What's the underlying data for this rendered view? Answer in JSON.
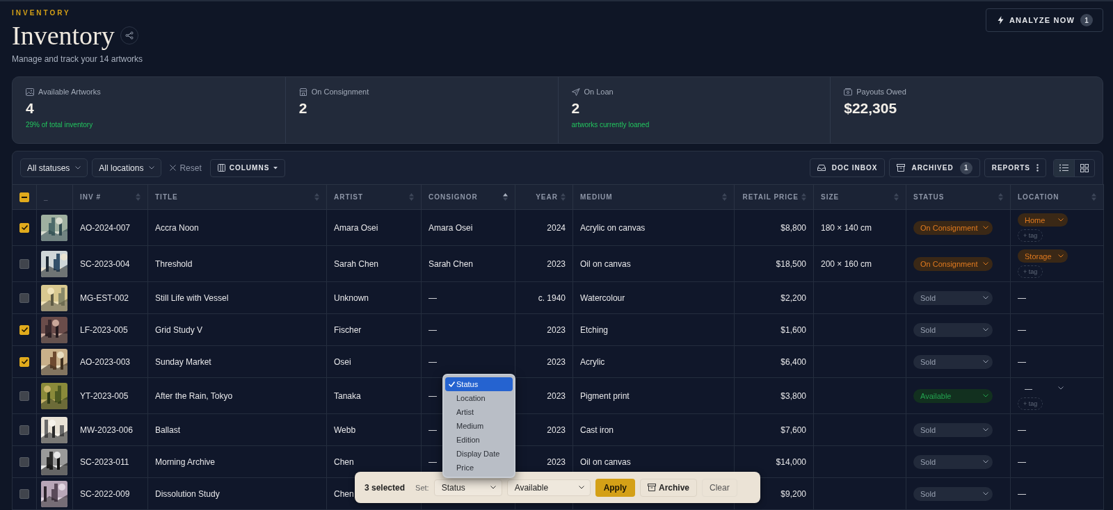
{
  "eyebrow": "INVENTORY",
  "title": "Inventory",
  "subtitle": "Manage and track your 14 artworks",
  "analyze": {
    "label": "ANALYZE NOW",
    "count": "1"
  },
  "stats": [
    {
      "label": "Available Artworks",
      "value": "4",
      "note": "29% of total inventory"
    },
    {
      "label": "On Consignment",
      "value": "2"
    },
    {
      "label": "On Loan",
      "value": "2",
      "note": "artworks currently loaned"
    },
    {
      "label": "Payouts Owed",
      "value": "$22,305"
    }
  ],
  "filters": [
    {
      "label": "All statuses"
    },
    {
      "label": "All locations"
    }
  ],
  "reset": "Reset",
  "columns_button": "COLUMNS",
  "actions": [
    {
      "kind": "inbox",
      "label": "DOC INBOX"
    },
    {
      "kind": "archive",
      "label": "ARCHIVED",
      "count": "1"
    },
    {
      "kind": "menu",
      "label": "REPORTS"
    }
  ],
  "views": [
    {
      "kind": "list",
      "selected": true
    },
    {
      "kind": "grid",
      "selected": false
    }
  ],
  "table": {
    "header_checkbox": {
      "checked": true,
      "indeterminate": true
    },
    "columns": [
      {
        "label": "_"
      },
      {
        "label": "INV #",
        "sorted": false
      },
      {
        "label": "TITLE",
        "sorted": false
      },
      {
        "label": "ARTIST",
        "sorted": false
      },
      {
        "label": "CONSIGNOR",
        "sorted": true
      },
      {
        "label": "YEAR",
        "sorted": false
      },
      {
        "label": "MEDIUM",
        "sorted": false
      },
      {
        "label": "RETAIL PRICE",
        "sorted": false
      },
      {
        "label": "SIZE",
        "sorted": false
      },
      {
        "label": "STATUS",
        "sorted": false
      },
      {
        "label": "LOCATION",
        "sorted": false
      }
    ],
    "rows": [
      {
        "selected": true,
        "inv": "AO-2024-007",
        "title": "Accra Noon",
        "artist": "Amara Osei",
        "consignor": "Amara Osei",
        "year": "2024",
        "medium": "Acrylic on canvas",
        "price": "$8,800",
        "size": "180 × 140 cm",
        "status": {
          "kind": "consignment",
          "label": "On Consignment"
        },
        "location": {
          "kind": "tag",
          "value": "Home",
          "add": "+ tag"
        }
      },
      {
        "selected": false,
        "inv": "SC-2023-004",
        "title": "Threshold",
        "artist": "Sarah Chen",
        "consignor": "Sarah Chen",
        "year": "2023",
        "medium": "Oil on canvas",
        "price": "$18,500",
        "size": "200 × 160 cm",
        "status": {
          "kind": "consignment",
          "label": "On Consignment"
        },
        "location": {
          "kind": "tag",
          "value": "Storage",
          "add": "+ tag"
        }
      },
      {
        "selected": false,
        "inv": "MG-EST-002",
        "title": "Still Life with Vessel",
        "artist": "Unknown",
        "consignor": "—",
        "year": "c. 1940",
        "medium": "Watercolour",
        "price": "$2,200",
        "status": {
          "kind": "sold",
          "label": "Sold"
        },
        "location": {
          "kind": "none",
          "value": "—"
        }
      },
      {
        "selected": true,
        "inv": "LF-2023-005",
        "title": "Grid Study V",
        "artist": "Fischer",
        "consignor": "—",
        "year": "2023",
        "medium": "Etching",
        "price": "$1,600",
        "status": {
          "kind": "sold",
          "label": "Sold"
        },
        "location": {
          "kind": "none",
          "value": "—"
        }
      },
      {
        "selected": true,
        "inv": "AO-2023-003",
        "title": "Sunday Market",
        "artist": "Osei",
        "consignor": "—",
        "year": "2023",
        "medium": "Acrylic",
        "price": "$6,400",
        "status": {
          "kind": "sold",
          "label": "Sold"
        },
        "location": {
          "kind": "none",
          "value": "—"
        }
      },
      {
        "selected": false,
        "inv": "YT-2023-005",
        "title": "After the Rain, Tokyo",
        "artist": "Tanaka",
        "consignor": "—",
        "year": "2023",
        "medium": "Pigment print",
        "price": "$3,800",
        "status": {
          "kind": "available",
          "label": "Available"
        },
        "location": {
          "kind": "select",
          "value": "—",
          "add": "+ tag"
        }
      },
      {
        "selected": false,
        "inv": "MW-2023-006",
        "title": "Ballast",
        "artist": "Webb",
        "consignor": "—",
        "year": "2023",
        "medium": "Cast iron",
        "price": "$7,600",
        "status": {
          "kind": "sold",
          "label": "Sold"
        },
        "location": {
          "kind": "none",
          "value": "—"
        }
      },
      {
        "selected": false,
        "inv": "SC-2023-011",
        "title": "Morning Archive",
        "artist": "Chen",
        "consignor": "—",
        "year": "2023",
        "medium": "Oil on canvas",
        "price": "$14,000",
        "status": {
          "kind": "sold",
          "label": "Sold"
        },
        "location": {
          "kind": "none",
          "value": "—"
        }
      },
      {
        "selected": false,
        "inv": "SC-2022-009",
        "title": "Dissolution Study",
        "artist": "Chen",
        "price": "$9,200",
        "status": {
          "kind": "sold",
          "label": "Sold"
        },
        "location": {
          "kind": "none",
          "value": "—"
        }
      }
    ]
  },
  "bulk": {
    "count": "3 selected",
    "set_label": "Set:",
    "field": "Status",
    "value": "Available",
    "apply": "Apply",
    "archive": "Archive",
    "clear": "Clear",
    "menu": [
      {
        "label": "Status",
        "selected": true
      },
      {
        "label": "Location",
        "selected": false
      },
      {
        "label": "Artist",
        "selected": false
      },
      {
        "label": "Medium",
        "selected": false
      },
      {
        "label": "Edition",
        "selected": false
      },
      {
        "label": "Display Date",
        "selected": false
      },
      {
        "label": "Price",
        "selected": false
      }
    ]
  }
}
